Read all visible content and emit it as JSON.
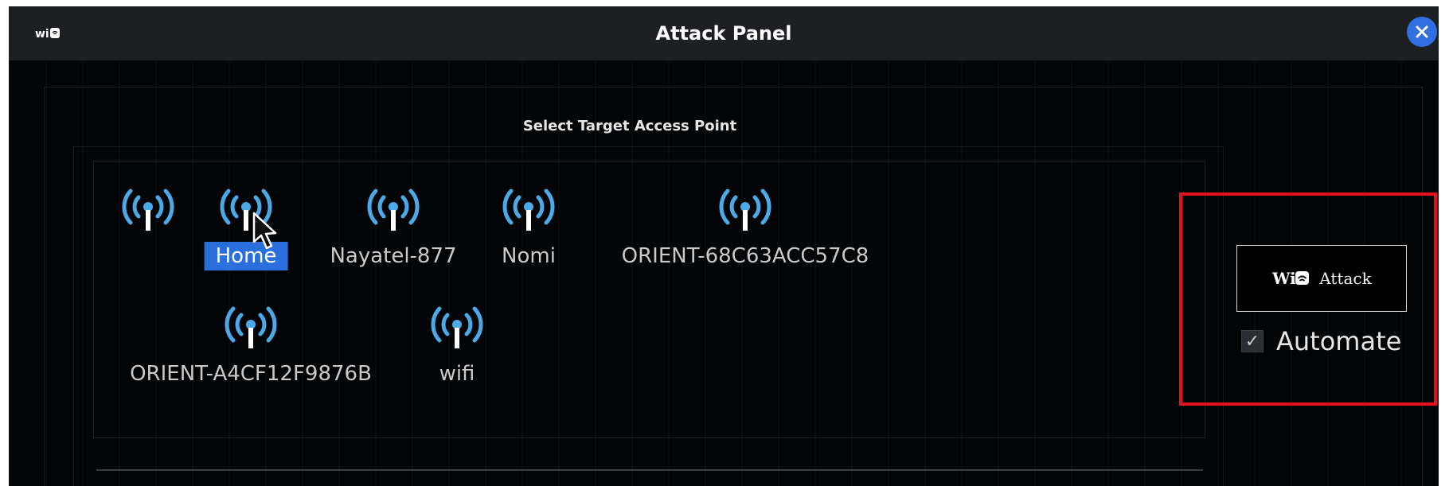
{
  "window": {
    "title": "Attack Panel",
    "app_icon": "wifi-logo-icon",
    "close_icon": "close-icon"
  },
  "panel": {
    "section_title": "Select Target Access Point"
  },
  "access_points": [
    {
      "label": "",
      "selected": false,
      "icon": "wifi-signal-icon"
    },
    {
      "label": "Home",
      "selected": true,
      "icon": "wifi-signal-icon"
    },
    {
      "label": "Nayatel-877",
      "selected": false,
      "icon": "wifi-signal-icon"
    },
    {
      "label": "Nomi",
      "selected": false,
      "icon": "wifi-signal-icon"
    },
    {
      "label": "ORIENT-68C63ACC57C8",
      "selected": false,
      "icon": "wifi-signal-icon"
    },
    {
      "label": "ORIENT-A4CF12F9876B",
      "selected": false,
      "icon": "wifi-signal-icon"
    },
    {
      "label": "wifi",
      "selected": false,
      "icon": "wifi-signal-icon"
    }
  ],
  "actions": {
    "attack_button": {
      "logo_text": "Wi",
      "label": "Attack"
    },
    "automate": {
      "label": "Automate",
      "checked": true,
      "check_glyph": "✓"
    }
  },
  "colors": {
    "accent": "#2a6fdc",
    "highlight": "#e3101e",
    "wifi_icon": "#4aa9e6",
    "background": "#020305"
  }
}
